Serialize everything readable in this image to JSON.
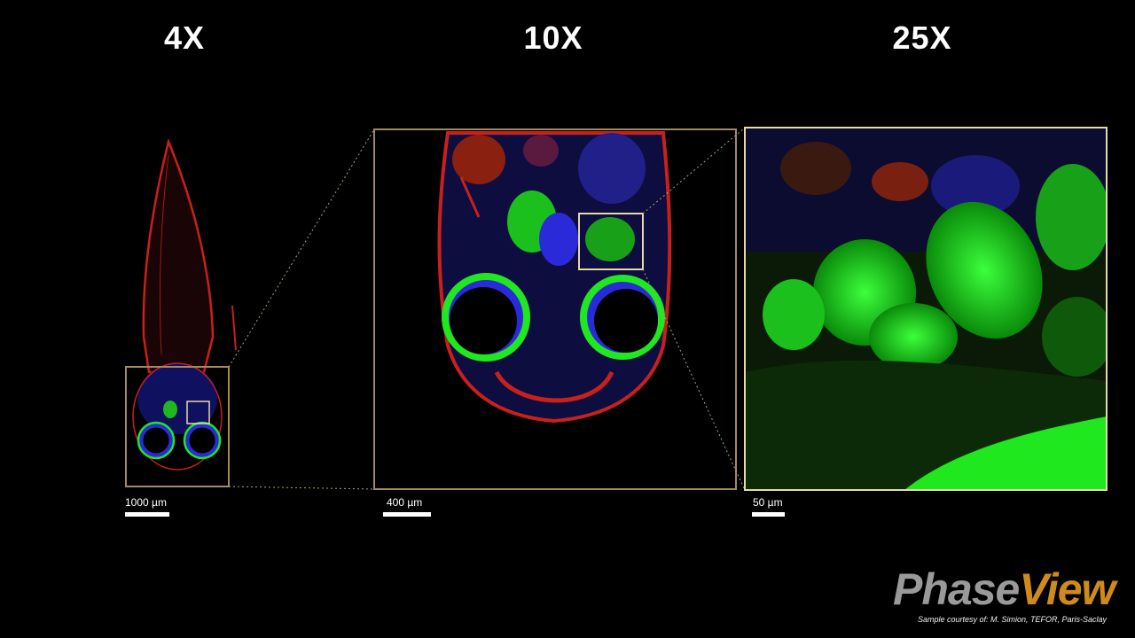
{
  "magnifications": [
    "4X",
    "10X",
    "25X"
  ],
  "scale_bars": [
    "1000 µm",
    "400 µm",
    "50 µm"
  ],
  "logo": {
    "part1": "Phase",
    "part2": "View"
  },
  "credit": "Sample courtesy of: M. Simion, TEFOR, Paris-Saclay",
  "colors": {
    "frame": "#a08a62",
    "zoom_box": "#e8d9a6",
    "green": "#1fe81f",
    "blue": "#2a2ad8",
    "red": "#c8201c"
  }
}
